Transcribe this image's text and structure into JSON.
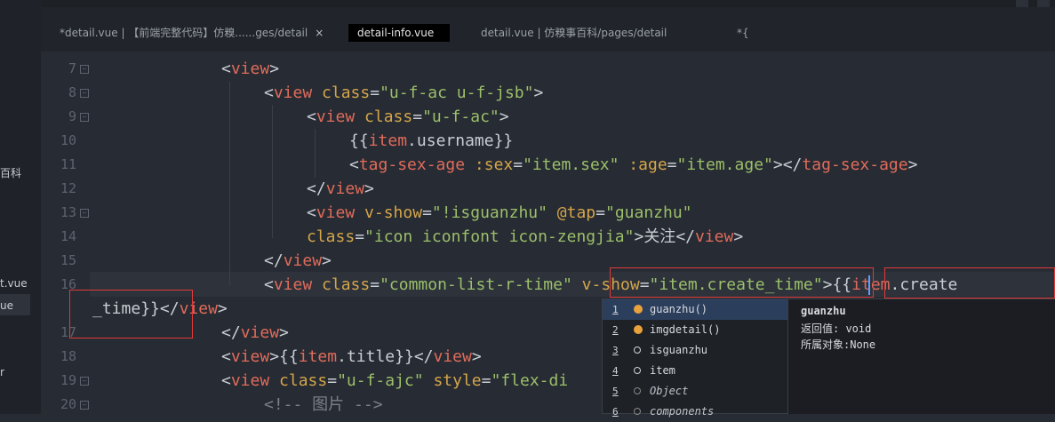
{
  "left_panel": {
    "fragments": [
      "百科",
      "t.vue",
      "ue",
      "r"
    ]
  },
  "tabs": [
    {
      "label": "*detail.vue | 【前端完整代码】仿糗......ges/detail",
      "close": "×"
    },
    {
      "label": "detail-info.vue"
    },
    {
      "label": "detail.vue | 仿糗事百科/pages/detail"
    },
    {
      "label": "*{"
    }
  ],
  "gutter": {
    "lines": [
      "7",
      "8",
      "9",
      "10",
      "11",
      "12",
      "13",
      "14",
      "15",
      "16",
      "17",
      "18",
      "19",
      "20"
    ],
    "fold_marker": "−"
  },
  "code": {
    "l7": {
      "open": "<",
      "tag": "view",
      "close": ">"
    },
    "l8": {
      "open": "<",
      "tag": "view",
      "attr": " class",
      "eq": "=",
      "val": "\"u-f-ac u-f-jsb\"",
      "close": ">"
    },
    "l9": {
      "open": "<",
      "tag": "view",
      "attr": " class",
      "eq": "=",
      "val": "\"u-f-ac\"",
      "close": ">"
    },
    "l10": {
      "pre": "{{",
      "obj": "item",
      "dot": ".",
      "prop": "username",
      "post": "}}"
    },
    "l11": {
      "open": "<",
      "tag": "tag-sex-age",
      "a1": " :sex",
      "eq1": "=",
      "v1": "\"item.sex\"",
      "a2": " :age",
      "eq2": "=",
      "v2": "\"item.age\"",
      "mid": "></",
      "tag2": "tag-sex-age",
      "close": ">"
    },
    "l12": {
      "open": "</",
      "tag": "view",
      "close": ">"
    },
    "l13": {
      "open": "<",
      "tag": "view",
      "a1": " v-show",
      "eq1": "=",
      "v1": "\"!isguanzhu\"",
      "a2": " @tap",
      "eq2": "=",
      "v2": "\"guanzhu\""
    },
    "l13b": {
      "attr": "class",
      "eq": "=",
      "val": "\"icon iconfont icon-zengjia\"",
      "gt": ">",
      "text": "关注",
      "open2": "</",
      "tag": "view",
      "close": ">"
    },
    "l15": {
      "open": "</",
      "tag": "view",
      "close": ">"
    },
    "l16": {
      "open": "<",
      "tag": "view",
      "a1": " class",
      "eq1": "=",
      "v1": "\"common-list-r-time\"",
      "a2": " v-show",
      "eq2": "=",
      "v2": "\"item.create_time\"",
      "gt": ">",
      "pre": "{{",
      "obj": "item",
      "dot": ".",
      "prop": "create"
    },
    "l16b": {
      "prop": "_time",
      "post": "}}",
      "open": "</",
      "tag": "view",
      "close": ">"
    },
    "l17": {
      "open": "</",
      "tag": "view",
      "close": ">"
    },
    "l18": {
      "open": "<",
      "tag": "view",
      "gt": ">",
      "pre": "{{",
      "obj": "item",
      "dot": ".",
      "prop": "title",
      "post": "}}",
      "open2": "</",
      "tag2": "view",
      "close": ">"
    },
    "l19": {
      "open": "<",
      "tag": "view",
      "attr": " class",
      "eq": "=",
      "val": "\"u-f-ajc\"",
      "a2": " style",
      "eq2": "=",
      "v2": "\"flex-di"
    },
    "l20": {
      "text": "<!-- 图片 -->"
    }
  },
  "autocomplete": {
    "items": [
      {
        "num": "1",
        "kind": "function",
        "label": "guanzhu()"
      },
      {
        "num": "2",
        "kind": "function",
        "label": "imgdetail()"
      },
      {
        "num": "3",
        "kind": "variable",
        "label": "isguanzhu"
      },
      {
        "num": "4",
        "kind": "variable",
        "label": "item"
      },
      {
        "num": "5",
        "kind": "object",
        "label": "Object"
      },
      {
        "num": "6",
        "kind": "object",
        "label": "components"
      }
    ],
    "selected_index": 0
  },
  "info_panel": {
    "name": "guanzhu",
    "return_label": "返回值: void",
    "owner_label": "所属对象:None"
  },
  "colors": {
    "tag": "#e06c5b",
    "attribute": "#d4a64a",
    "string": "#9bbf6a",
    "highlight_box": "#e23b3b",
    "cursor": "#5aa0ff"
  }
}
